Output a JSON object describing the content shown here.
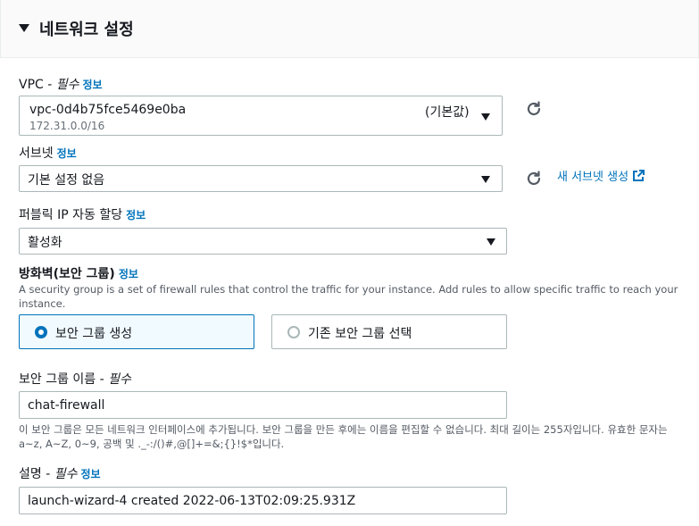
{
  "header": {
    "title": "네트워크 설정"
  },
  "vpc": {
    "label": "VPC - ",
    "required": "필수",
    "info": "정보",
    "value": "vpc-0d4b75fce5469e0ba",
    "cidr": "172.31.0.0/16",
    "default_tag": "(기본값)"
  },
  "subnet": {
    "label": "서브넷",
    "info": "정보",
    "value": "기본 설정 없음",
    "new_link": "새 서브넷 생성"
  },
  "public_ip": {
    "label": "퍼블릭 IP 자동 할당",
    "info": "정보",
    "value": "활성화"
  },
  "firewall": {
    "label": "방화벽(보안 그룹)",
    "info": "정보",
    "description": "A security group is a set of firewall rules that control the traffic for your instance. Add rules to allow specific traffic to reach your instance.",
    "options": [
      {
        "label": "보안 그룹 생성",
        "selected": true
      },
      {
        "label": "기존 보안 그룹 선택",
        "selected": false
      }
    ]
  },
  "sg_name": {
    "label": "보안 그룹 이름 - ",
    "required": "필수",
    "value": "chat-firewall",
    "hint": "이 보안 그룹은 모든 네트워크 인터페이스에 추가됩니다. 보안 그룹을 만든 후에는 이름을 편집할 수 없습니다. 최대 길이는 255자입니다. 유효한 문자는 a~z, A~Z, 0~9, 공백 및 ._-:/()#,@[]+=&;{}!$*입니다."
  },
  "sg_desc": {
    "label": "설명 - ",
    "required": "필수",
    "info": "정보",
    "value": "launch-wizard-4 created 2022-06-13T02:09:25.931Z"
  },
  "colors": {
    "link": "#0073bb",
    "border": "#aab7b8",
    "selected_bg": "#f1faff"
  },
  "icons": {
    "refresh": "refresh-icon",
    "external": "external-link-icon",
    "caret": "caret-down-icon"
  }
}
